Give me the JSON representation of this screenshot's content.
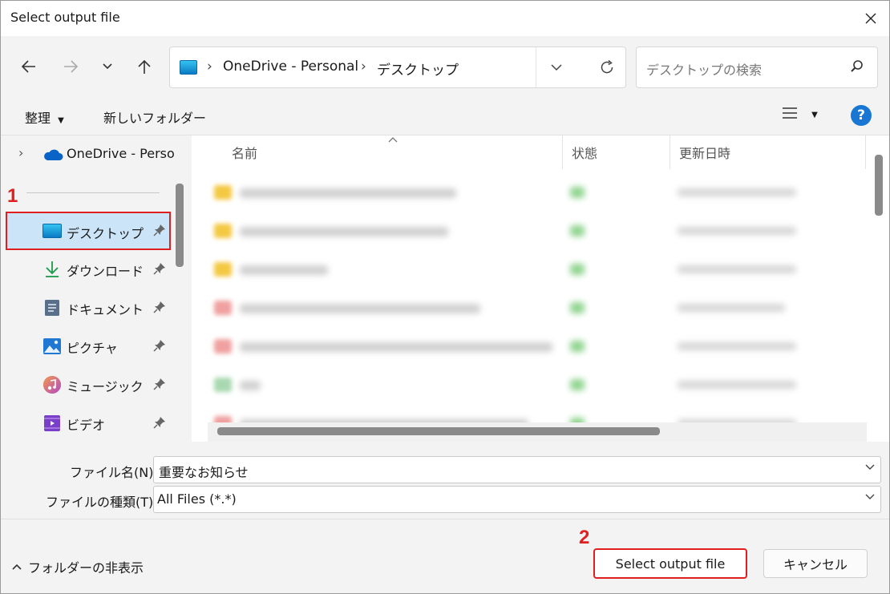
{
  "window": {
    "title": "Select output file"
  },
  "address": {
    "crumbs": [
      "OneDrive - Personal",
      "デスクトップ"
    ]
  },
  "search": {
    "placeholder": "デスクトップの検索"
  },
  "commands": {
    "organize": "整理",
    "new_folder": "新しいフォルダー"
  },
  "sidebar": {
    "tree_item": "OneDrive - Perso",
    "items": [
      {
        "label": "デスクトップ",
        "icon": "desktop-folder-icon",
        "selected": true
      },
      {
        "label": "ダウンロード",
        "icon": "download-arrow-icon"
      },
      {
        "label": "ドキュメント",
        "icon": "document-icon"
      },
      {
        "label": "ピクチャ",
        "icon": "picture-icon"
      },
      {
        "label": "ミュージック",
        "icon": "music-icon"
      },
      {
        "label": "ビデオ",
        "icon": "video-icon"
      }
    ]
  },
  "columns": {
    "name": "名前",
    "status": "状態",
    "modified": "更新日時"
  },
  "form": {
    "filename_label": "ファイル名(N):",
    "filename_value": "重要なお知らせ",
    "filetype_label": "ファイルの種類(T):",
    "filetype_value": "All Files (*.*)"
  },
  "footer": {
    "hide_folders": "フォルダーの非表示",
    "primary_button": "Select output file",
    "cancel_button": "キャンセル"
  },
  "annotations": {
    "step1": "1",
    "step2": "2"
  },
  "colors": {
    "selection": "#cce4f7",
    "annotation": "#e02020",
    "help": "#1976d2"
  }
}
